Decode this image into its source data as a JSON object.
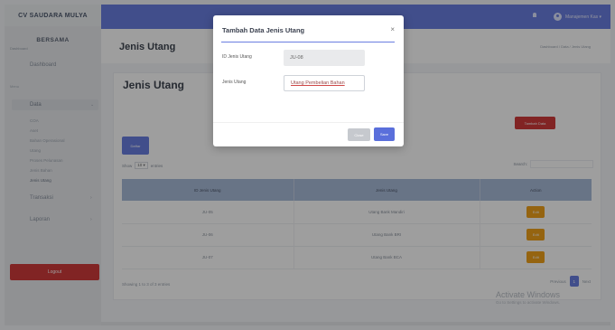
{
  "sidebar": {
    "brand": "CV SAUDARA MULYA",
    "company": "BERSAMA",
    "company_sub": "Dashboard",
    "dashboard_label": "Dashboard",
    "section_label": "Menu",
    "data_label": "Data",
    "data_items": [
      "COA",
      "Aset",
      "Bahan Operasional",
      "Utang",
      "Proses Pelunasan",
      "Jenis Bahan",
      "Jenis Utang"
    ],
    "transaksi_label": "Transaksi",
    "laporan_label": "Laporan",
    "logout_label": "Logout"
  },
  "topbar": {
    "user_label": "Manajemen Kas ▾"
  },
  "header": {
    "title": "Jenis Utang",
    "breadcrumb": "Dashboard / Data / Jenis Utang"
  },
  "card": {
    "title": "Jenis Utang",
    "add_button": "Tambah Data",
    "list_button": "Daftar",
    "show_label": "Show",
    "entries_value": "10 ▾",
    "entries_label": "entries",
    "search_label": "Search:",
    "table": {
      "headers": [
        "ID Jenis Utang",
        "Jenis Utang",
        "Action"
      ],
      "rows": [
        {
          "id": "JU-05",
          "jenis": "Utang Bank Mandiri",
          "action": "Edit"
        },
        {
          "id": "JU-06",
          "jenis": "Utang Bank BRI",
          "action": "Edit"
        },
        {
          "id": "JU-07",
          "jenis": "Utang Bank BCA",
          "action": "Edit"
        }
      ]
    },
    "showing_text": "Showing 1 to 3 of 3 entries",
    "pager_prev": "Previous",
    "pager_page": "1",
    "pager_next": "Next"
  },
  "watermark": {
    "title": "Activate Windows",
    "subtitle": "Go to Settings to activate Windows."
  },
  "modal": {
    "title": "Tambah Data Jenis Utang",
    "close_icon": "×",
    "id_label": "ID Jenis Utang",
    "id_value": "JU-08",
    "jenis_label": "Jenis Utang",
    "jenis_value": "Utang Pembelian Bahan",
    "close_button": "Close",
    "save_button": "Save"
  },
  "colors": {
    "accent": "#6a7ee0",
    "danger": "#d03a3a",
    "warning": "#f0a21b"
  }
}
